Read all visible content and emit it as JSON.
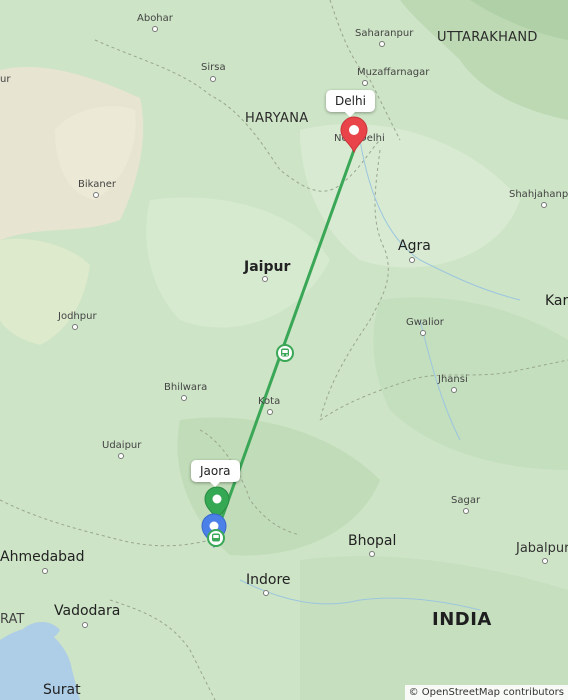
{
  "map": {
    "places": [
      {
        "id": "abohar",
        "name": "Abohar"
      },
      {
        "id": "sirsa",
        "name": "Sirsa"
      },
      {
        "id": "saharanpur",
        "name": "Saharanpur"
      },
      {
        "id": "muzaffarnagar",
        "name": "Muzaffarnagar"
      },
      {
        "id": "new-delhi",
        "name": "New Delhi"
      },
      {
        "id": "bikaner",
        "name": "Bikaner"
      },
      {
        "id": "shahjahanpur",
        "name": "Shahjahanpur"
      },
      {
        "id": "agra",
        "name": "Agra"
      },
      {
        "id": "jaipur",
        "name": "Jaipur"
      },
      {
        "id": "jodhpur",
        "name": "Jodhpur"
      },
      {
        "id": "gwalior",
        "name": "Gwalior"
      },
      {
        "id": "bhilwara",
        "name": "Bhilwara"
      },
      {
        "id": "jhansi",
        "name": "Jhansi"
      },
      {
        "id": "kota",
        "name": "Kota"
      },
      {
        "id": "udaipur",
        "name": "Udaipur"
      },
      {
        "id": "sagar",
        "name": "Sagar"
      },
      {
        "id": "ahmedabad",
        "name": "Ahmedabad"
      },
      {
        "id": "bhopal",
        "name": "Bhopal"
      },
      {
        "id": "jabalpur",
        "name": "Jabalpur"
      },
      {
        "id": "indore",
        "name": "Indore"
      },
      {
        "id": "vadodara",
        "name": "Vadodara"
      },
      {
        "id": "surat",
        "name": "Surat"
      }
    ],
    "partial_labels": {
      "left_edge": "ur",
      "right_edge": "Kar",
      "bottom_left": "RAT"
    },
    "regions": {
      "haryana": "HARYANA",
      "uttarakhand": "UTTARAKHAND",
      "india": "INDIA"
    },
    "route": {
      "origin_label": "Jaora",
      "destination_label": "Delhi",
      "line_color": "#3aa757",
      "transit_icon": "train-icon"
    },
    "markers": {
      "origin_color": "#34a853",
      "destination_color": "#e8444a",
      "current_location_color": "#4a80e8"
    },
    "attribution": "© OpenStreetMap contributors"
  }
}
